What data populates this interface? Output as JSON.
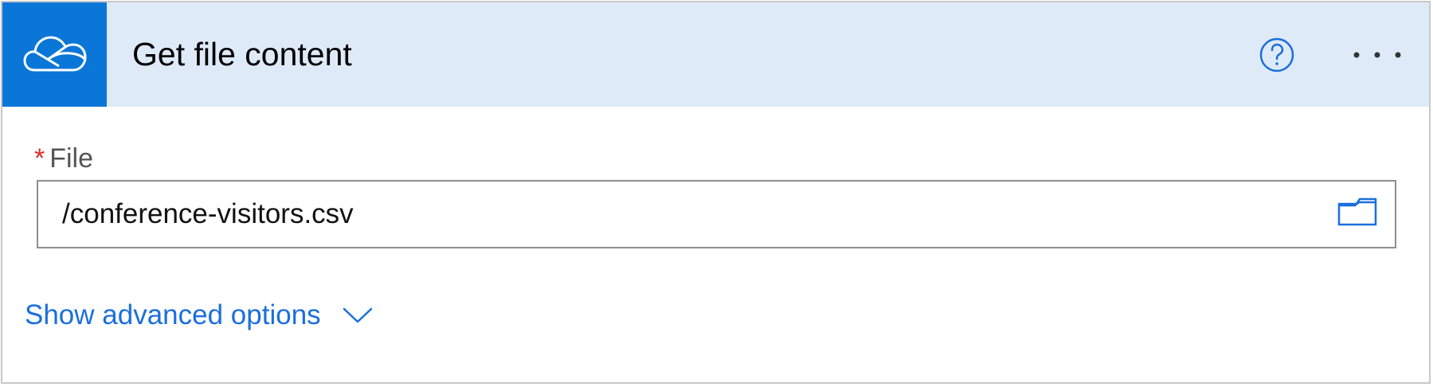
{
  "header": {
    "title": "Get file content",
    "service_icon": "onedrive-cloud-icon",
    "help_icon": "help-circle-icon",
    "more_icon": "more-horizontal-icon"
  },
  "field": {
    "required_mark": "*",
    "label": "File",
    "value": "/conference-visitors.csv",
    "picker_icon": "folder-icon"
  },
  "advanced": {
    "label": "Show advanced options",
    "icon": "chevron-down-icon"
  },
  "colors": {
    "header_bg": "#dfeaf8",
    "icon_tile_bg": "#0a77d8",
    "link": "#1a6fdc",
    "required": "#d92b2b"
  }
}
